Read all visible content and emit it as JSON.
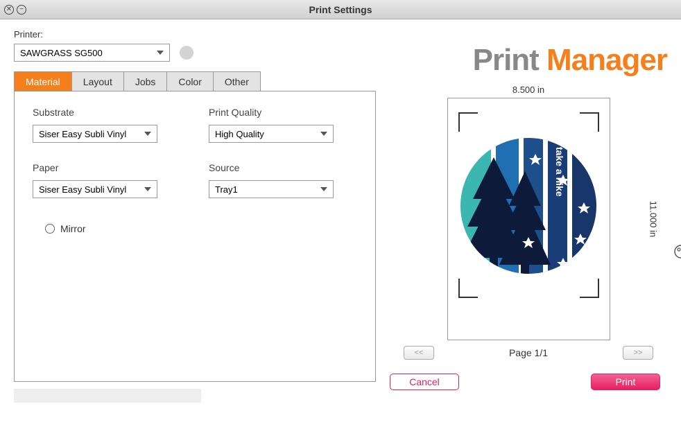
{
  "titlebar": {
    "title": "Print Settings"
  },
  "printer": {
    "label": "Printer:",
    "selected": "SAWGRASS SG500"
  },
  "tabs": [
    {
      "label": "Material",
      "active": true
    },
    {
      "label": "Layout",
      "active": false
    },
    {
      "label": "Jobs",
      "active": false
    },
    {
      "label": "Color",
      "active": false
    },
    {
      "label": "Other",
      "active": false
    }
  ],
  "form": {
    "substrate": {
      "label": "Substrate",
      "selected": "Siser Easy Subli Vinyl"
    },
    "print_quality": {
      "label": "Print Quality",
      "selected": "High Quality"
    },
    "paper": {
      "label": "Paper",
      "selected": "Siser Easy Subli Vinyl"
    },
    "source": {
      "label": "Source",
      "selected": "Tray1"
    },
    "mirror": {
      "label": "Mirror",
      "checked": false
    }
  },
  "brand": {
    "word1": "Print ",
    "word2": "Manager"
  },
  "preview": {
    "width_label": "8.500 in",
    "height_label": "11.000 in",
    "artwork_text": "take a hike"
  },
  "pager": {
    "prev": "<<",
    "next": ">>",
    "label": "Page 1/1"
  },
  "actions": {
    "cancel": "Cancel",
    "print": "Print"
  },
  "colors": {
    "accent": "#f77f1b",
    "pink": "#e91e63"
  }
}
